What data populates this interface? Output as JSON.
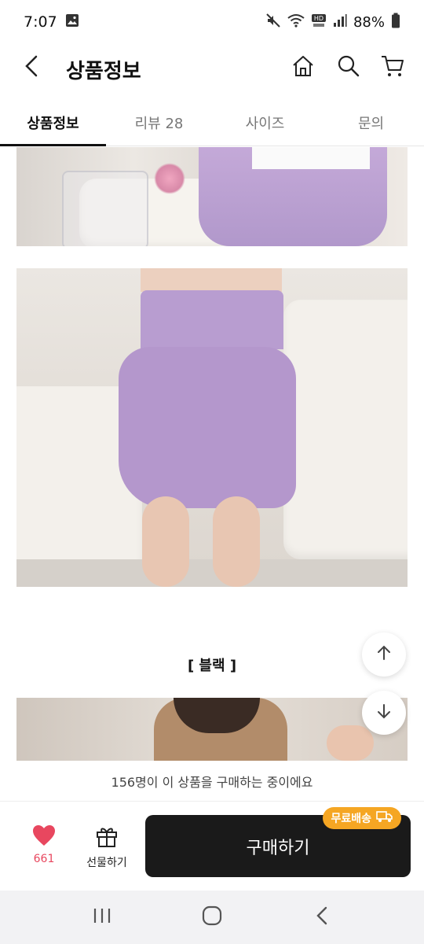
{
  "status": {
    "time": "7:07",
    "battery": "88%",
    "icons": [
      "gallery-icon",
      "mute-icon",
      "wifi-icon",
      "hd-voice-icon",
      "signal-icon",
      "battery-icon"
    ]
  },
  "header": {
    "title": "상품정보",
    "icons": [
      "back-arrow-icon",
      "home-icon",
      "search-icon",
      "cart-icon"
    ]
  },
  "tabs": [
    {
      "label": "상품정보",
      "active": true
    },
    {
      "label": "리뷰 28",
      "active": false
    },
    {
      "label": "사이즈",
      "active": false
    },
    {
      "label": "문의",
      "active": false
    }
  ],
  "content": {
    "section_label": "[ 블랙 ]"
  },
  "buyers_banner": "156명이 이 상품을 구매하는 중이에요",
  "actions": {
    "like_count": "661",
    "gift_label": "선물하기",
    "buy_label": "구매하기",
    "shipping_badge": "무료배송"
  },
  "colors": {
    "accent_like": "#e8475f",
    "buy_button": "#1a1a1a",
    "shipping_badge": "#f5a623",
    "skirt": "#b79ccf"
  }
}
